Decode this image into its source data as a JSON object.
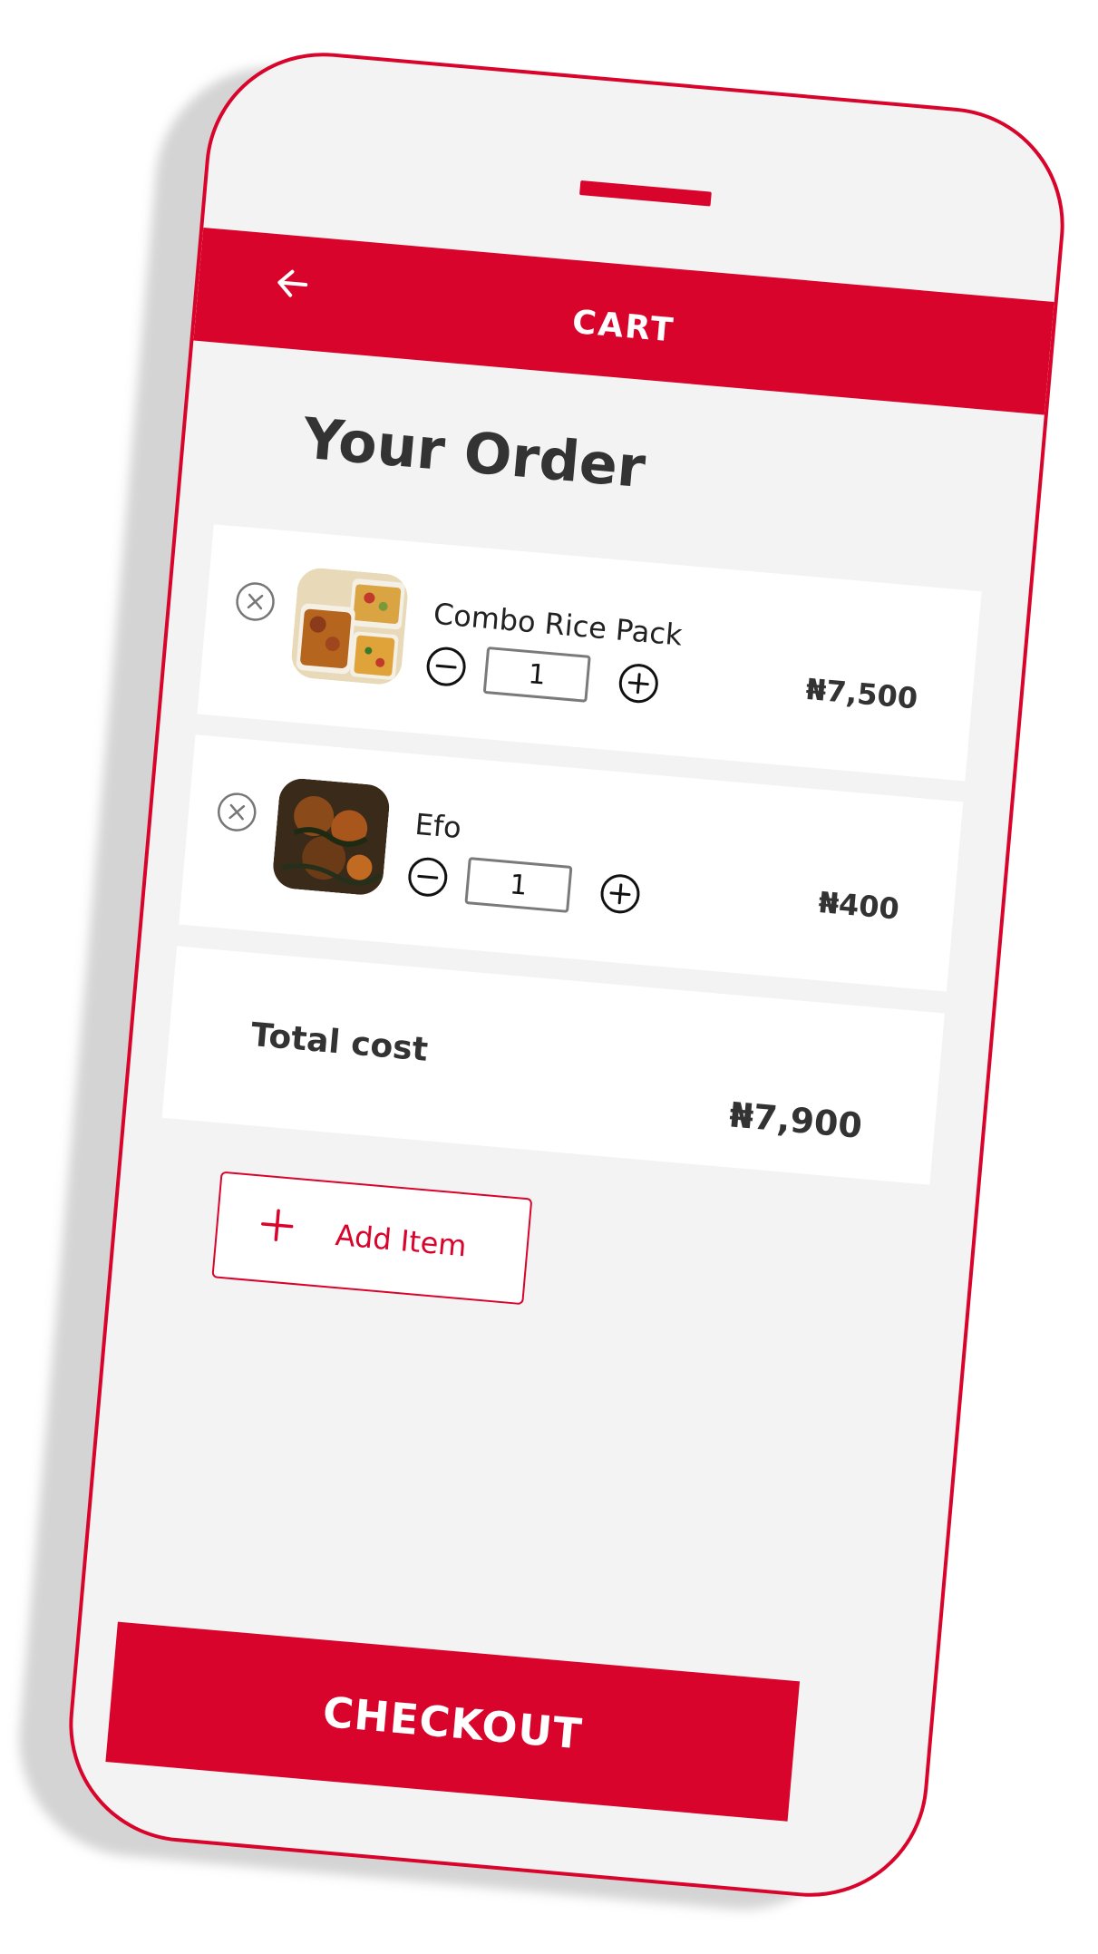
{
  "colors": {
    "accent": "#d9042b",
    "background": "#f3f3f3",
    "card": "#ffffff",
    "text": "#333333"
  },
  "header": {
    "title": "CART",
    "back_icon": "arrow-left-icon"
  },
  "page_title": "Your Order",
  "items": [
    {
      "name": "Combo Rice Pack",
      "quantity": "1",
      "price": "₦7,500",
      "image": "combo-rice-pack-photo",
      "remove_icon": "close-circle-icon",
      "minus_icon": "minus-circle-icon",
      "plus_icon": "plus-circle-icon"
    },
    {
      "name": "Efo",
      "quantity": "1",
      "price": "₦400",
      "image": "efo-photo",
      "remove_icon": "close-circle-icon",
      "minus_icon": "minus-circle-icon",
      "plus_icon": "plus-circle-icon"
    }
  ],
  "total": {
    "label": "Total cost",
    "value": "₦7,900"
  },
  "add_item": {
    "label": "Add Item",
    "icon": "plus-icon"
  },
  "checkout": {
    "label": "CHECKOUT"
  }
}
